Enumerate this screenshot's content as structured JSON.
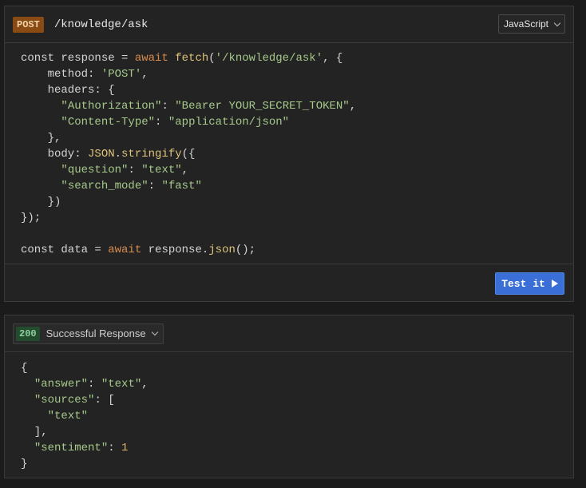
{
  "request": {
    "method": "POST",
    "path": "/knowledge/ask",
    "language": "JavaScript",
    "test_label": "Test it",
    "code": {
      "l1": {
        "a": "const response = ",
        "b": "await ",
        "c": "fetch",
        "d": "(",
        "e": "'/knowledge/ask'",
        "f": ", {"
      },
      "l2": {
        "a": "    method: ",
        "b": "'POST'",
        "c": ","
      },
      "l3": "    headers: {",
      "l4": {
        "a": "      ",
        "b": "\"Authorization\"",
        "c": ": ",
        "d": "\"Bearer YOUR_SECRET_TOKEN\"",
        "e": ","
      },
      "l5": {
        "a": "      ",
        "b": "\"Content-Type\"",
        "c": ": ",
        "d": "\"application/json\""
      },
      "l6": "    },",
      "l7": {
        "a": "    body: ",
        "b": "JSON",
        "c": ".",
        "d": "stringify",
        "e": "({"
      },
      "l8": {
        "a": "      ",
        "b": "\"question\"",
        "c": ": ",
        "d": "\"text\"",
        "e": ","
      },
      "l9": {
        "a": "      ",
        "b": "\"search_mode\"",
        "c": ": ",
        "d": "\"fast\""
      },
      "l10": "    })",
      "l11": "});",
      "l13": {
        "a": "const data = ",
        "b": "await ",
        "c": "response.",
        "d": "json",
        "e": "();"
      }
    }
  },
  "response": {
    "status_code": "200",
    "status_text": "Successful Response",
    "code": {
      "r1": "{",
      "r2": {
        "a": "  ",
        "b": "\"answer\"",
        "c": ": ",
        "d": "\"text\"",
        "e": ","
      },
      "r3": {
        "a": "  ",
        "b": "\"sources\"",
        "c": ": ["
      },
      "r4": {
        "a": "    ",
        "b": "\"text\""
      },
      "r5": "  ],",
      "r6": {
        "a": "  ",
        "b": "\"sentiment\"",
        "c": ": ",
        "d": "1"
      },
      "r7": "}"
    }
  }
}
